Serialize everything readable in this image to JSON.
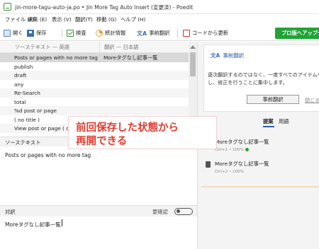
{
  "window": {
    "title": "jin-more-tagu-auto-ja.po • Jin More Tag Auto Insert (変更済) - Poedit"
  },
  "menu": [
    "ファイル (F)",
    "編集 (E)",
    "表示 (V)",
    "翻訳(T)",
    "移動 (G)",
    "ヘルプ (H)"
  ],
  "toolbar": {
    "open": "開く",
    "save": "保存",
    "validate": "検査",
    "stats": "統計情報",
    "pretranslate": "事前翻訳",
    "update_from_code": "コードから更新",
    "pro": "プロ版へアップグ"
  },
  "list": {
    "col_source": "ソーステキスト — 英語",
    "col_translation": "翻訳 — 日本語",
    "rows": [
      {
        "source": "Posts or pages with no more tag",
        "translation": "Moreタグなし記事一覧",
        "selected": true
      },
      {
        "source": "publish",
        "translation": ""
      },
      {
        "source": "draft",
        "translation": ""
      },
      {
        "source": "any",
        "translation": ""
      },
      {
        "source": "Re-Search",
        "translation": ""
      },
      {
        "source": "total",
        "translation": ""
      },
      {
        "source": "%d post or page",
        "translation": ""
      },
      {
        "source": "( no title )",
        "translation": ""
      },
      {
        "source": "View post or page ( op",
        "translation": ""
      }
    ]
  },
  "source_panel": {
    "label": "ソーステキスト",
    "text": "Posts or pages with no more tag"
  },
  "translation_panel": {
    "label": "対訳",
    "fuzzy_label": "要確認",
    "text": "Moreタグなし記事一覧"
  },
  "pretranslate_card": {
    "title": "事前翻訳",
    "line1": "逐次翻訳するのではなく、一度すべてのアイテムを",
    "line2": "し、修正を行うことに集中します。",
    "button": "事前翻訳",
    "close": "閉じる"
  },
  "sidebar_tabs": {
    "suggestions": "提案",
    "glossary": "用語"
  },
  "suggestions": [
    {
      "title": "Moreタグなし記事一覧",
      "meta": "Ctrl+1 • 100%"
    },
    {
      "title": "Moreタグなし記事一覧",
      "meta": "Ctrl+2 • 100%"
    }
  ],
  "overlay": {
    "line1": "前回保存した状態から",
    "line2": "再開できる"
  },
  "colors": {
    "accent_blue": "#2a5aa8",
    "pro_green": "#21a336",
    "overlay_red": "#e33b2e"
  }
}
